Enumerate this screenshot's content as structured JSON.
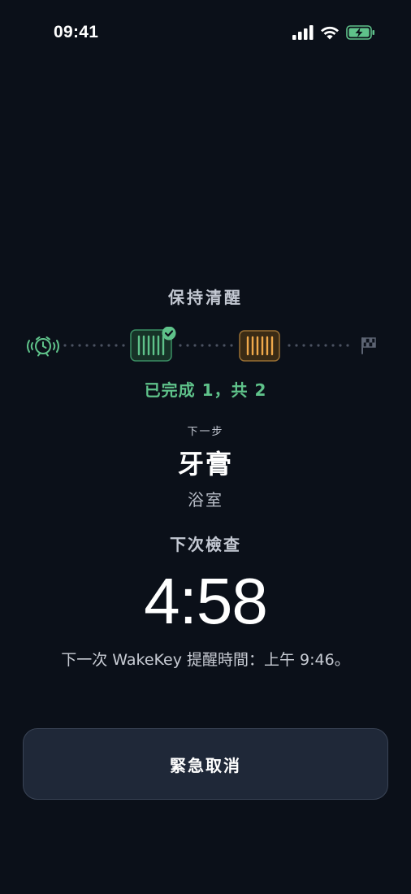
{
  "status_bar": {
    "time": "09:41",
    "icons": [
      "signal-icon",
      "wifi-icon",
      "battery-charging-icon"
    ]
  },
  "title": "保持清醒",
  "track": {
    "start_icon": "alarm-clock-icon",
    "end_icon": "checkered-flag-icon",
    "steps": [
      {
        "icon": "barcode-icon",
        "state": "completed",
        "color": "#5fc28a"
      },
      {
        "icon": "barcode-icon",
        "state": "current",
        "color": "#f0a94b"
      }
    ]
  },
  "progress_text": "已完成 1，共 2",
  "next": {
    "label": "下一步",
    "item": "牙膏",
    "location": "浴室"
  },
  "next_check": {
    "label": "下次檢查",
    "countdown": "4:58"
  },
  "reminder_text": "下一次 WakeKey 提醒時間：上午 9:46。",
  "emergency_button": {
    "label": "緊急取消"
  },
  "colors": {
    "background": "#0b1019",
    "accent_green": "#5fc28a",
    "accent_orange": "#f0a94b",
    "button_bg": "#1f2838"
  }
}
